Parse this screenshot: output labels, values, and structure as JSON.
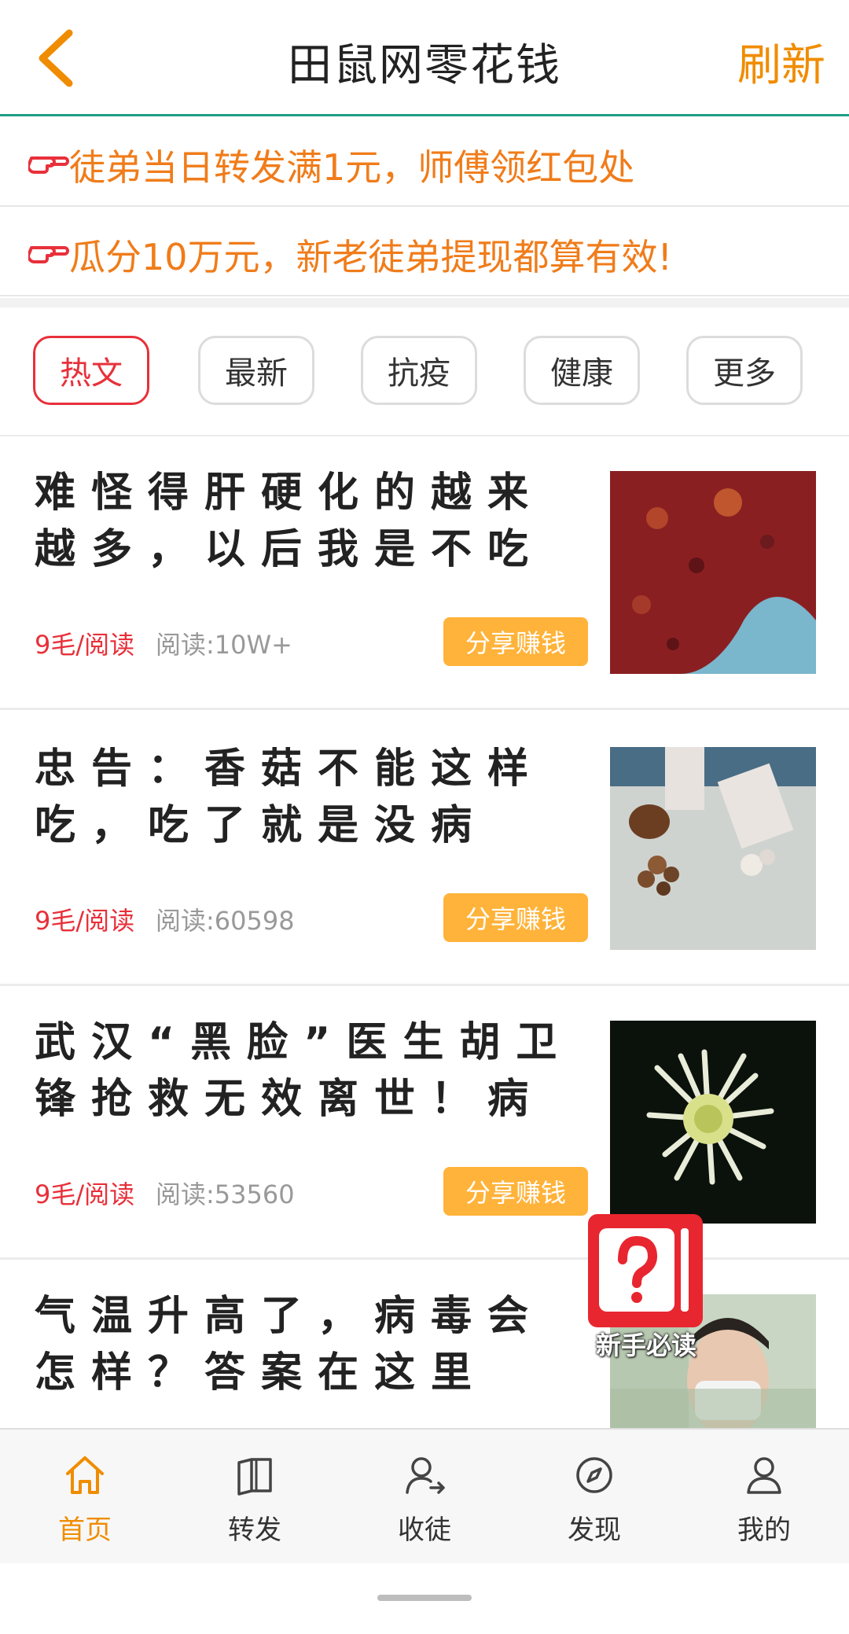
{
  "header": {
    "title": "田鼠网零花钱",
    "refresh_label": "刷新",
    "back_icon": "chevron-left-icon"
  },
  "notices": [
    {
      "text": "徒弟当日转发满1元，师傅领红包处",
      "icon": "pointing-hand-icon"
    },
    {
      "text": "瓜分10万元，新老徒弟提现都算有效!",
      "icon": "pointing-hand-icon"
    }
  ],
  "tabs": [
    {
      "label": "热文",
      "active": true
    },
    {
      "label": "最新",
      "active": false
    },
    {
      "label": "抗疫",
      "active": false
    },
    {
      "label": "健康",
      "active": false
    },
    {
      "label": "更多",
      "active": false
    }
  ],
  "articles": [
    {
      "title": "难怪得肝硬化的越来越多，以后我是不吃了！",
      "price": "9毛/阅读",
      "reads": "阅读:10W+",
      "share_label": "分享赚钱",
      "image": "liver-photo"
    },
    {
      "title": "忠告：香菇不能这样吃，吃了就是没病找…",
      "price": "9毛/阅读",
      "reads": "阅读:60598",
      "share_label": "分享赚钱",
      "image": "mushroom-cutting-photo"
    },
    {
      "title": "武汉“黑脸”医生胡卫锋抢救无效离世！病情…",
      "price": "9毛/阅读",
      "reads": "阅读:53560",
      "share_label": "分享赚钱",
      "image": "white-chrysanthemum-photo"
    },
    {
      "title": "气温升高了，病毒会怎样？答案在这里",
      "image": "masked-person-photo"
    }
  ],
  "floating_guide": {
    "label": "新手必读",
    "icon": "question-mark-icon"
  },
  "bottom_nav": [
    {
      "label": "首页",
      "icon": "home-icon",
      "active": true
    },
    {
      "label": "转发",
      "icon": "book-icon",
      "active": false
    },
    {
      "label": "收徒",
      "icon": "user-add-icon",
      "active": false
    },
    {
      "label": "发现",
      "icon": "compass-icon",
      "active": false
    },
    {
      "label": "我的",
      "icon": "person-icon",
      "active": false
    }
  ],
  "colors": {
    "accent": "#f08c00",
    "notice_text": "#f07c1a",
    "active_tab": "#e8303a",
    "price": "#e8303a",
    "share_button": "#ffb33a",
    "header_border": "#1f9e86"
  }
}
